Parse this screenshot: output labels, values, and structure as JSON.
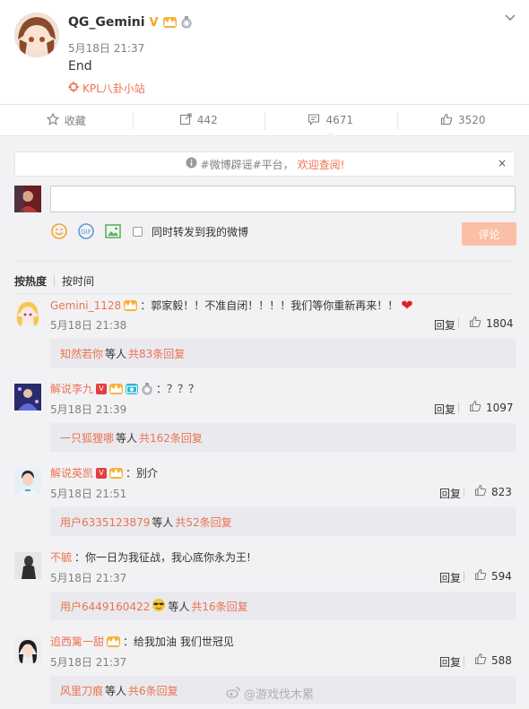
{
  "post": {
    "author": "QG_Gemini",
    "time": "5月18日 21:37",
    "text": "End",
    "source": "KPL八卦小站",
    "menu_icon": "chevron-down-icon"
  },
  "actions": [
    {
      "label": "收藏",
      "icon": "star-icon"
    },
    {
      "label": "442",
      "icon": "repost-icon"
    },
    {
      "label": "4671",
      "icon": "comment-icon"
    },
    {
      "label": "3520",
      "icon": "thumb-up-icon"
    }
  ],
  "notice": {
    "prefix": "#微博辟谣#平台，",
    "link": "欢迎查阅!",
    "close": "×"
  },
  "compose": {
    "sync_label": "同时转发到我的微博",
    "submit_label": "评论"
  },
  "sort": {
    "hot": "按热度",
    "time": "按时间"
  },
  "comments": [
    {
      "user": "Gemini_1128",
      "text": "：郭家毅！！不准自闭！！！！我们等你重新再来！！",
      "time": "5月18日 21:38",
      "reply": "回复",
      "likes": "1804",
      "sub_by": "知然若你",
      "sub_mid": "等人",
      "sub_count": "共83条回复"
    },
    {
      "user": "解说李九",
      "text": "：？？？",
      "time": "5月18日 21:39",
      "reply": "回复",
      "likes": "1097",
      "sub_by": "一只狐狸哪",
      "sub_mid": "等人",
      "sub_count": "共162条回复"
    },
    {
      "user": "解说英凯",
      "text": "：别介",
      "time": "5月18日 21:51",
      "reply": "回复",
      "likes": "823",
      "sub_by": "用户6335123879",
      "sub_mid": "等人",
      "sub_count": "共52条回复"
    },
    {
      "user": "不毓",
      "text": "：你一日为我征战，我心底你永为王!",
      "time": "5月18日 21:37",
      "reply": "回复",
      "likes": "594",
      "sub_by": "用户6449160422",
      "sub_mid": "等人",
      "sub_count": "共16条回复"
    },
    {
      "user": "追西篱一甜",
      "text": "：给我加油 我们世冠见",
      "time": "5月18日 21:37",
      "reply": "回复",
      "likes": "588",
      "sub_by": "风里刀痕",
      "sub_mid": "等人",
      "sub_count": "共6条回复"
    }
  ],
  "watermark": "@游戏伐木累",
  "colors": {
    "accent": "#eb7350",
    "submit_bg": "#fbbfa5",
    "comment_bg": "#f2f2f5"
  }
}
